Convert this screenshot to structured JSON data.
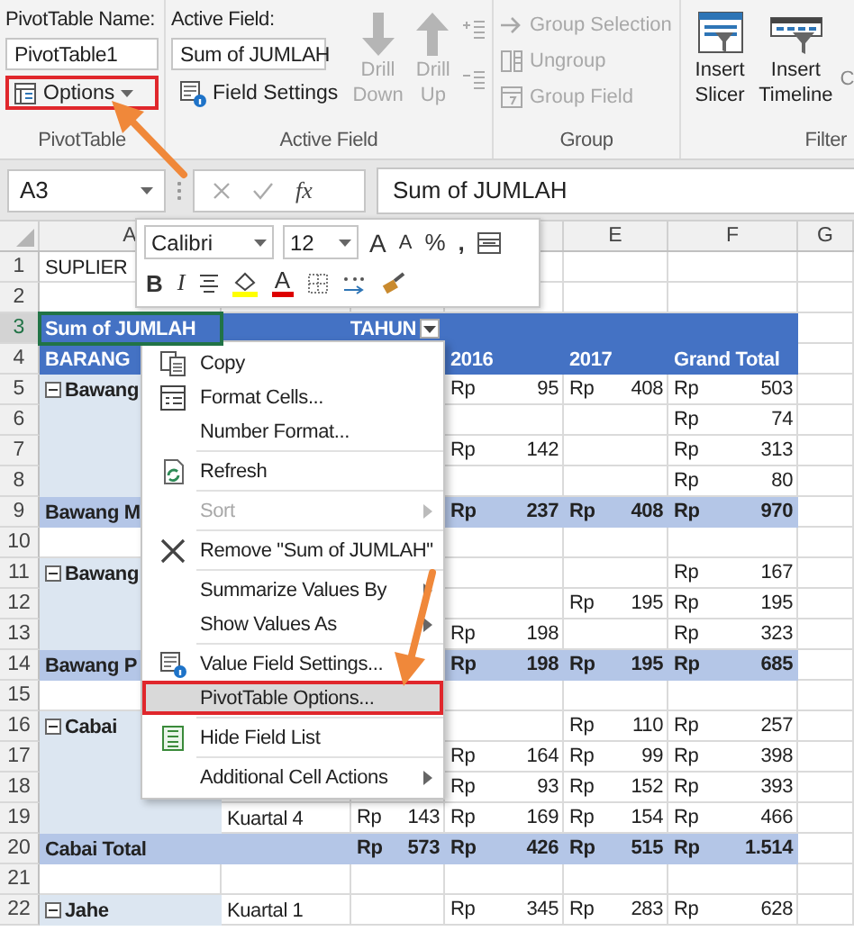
{
  "ribbon": {
    "pivottable_group": {
      "name_label": "PivotTable Name:",
      "name_value": "PivotTable1",
      "options_button": {
        "label": "Options",
        "highlighted": true
      },
      "label": "PivotTable"
    },
    "active_field_group": {
      "field_label": "Active Field:",
      "field_value": "Sum of JUMLAH",
      "settings_button": "Field Settings",
      "drill_buttons": [
        {
          "label": "Drill Down",
          "disabled": true
        },
        {
          "label": "Drill Up",
          "disabled": true
        }
      ],
      "label": "Active Field"
    },
    "group_group": {
      "buttons": [
        {
          "label": "Group Selection",
          "disabled": true
        },
        {
          "label": "Ungroup",
          "disabled": true
        },
        {
          "label": "Group Field",
          "disabled": true
        }
      ],
      "label": "Group"
    },
    "filter_group": {
      "buttons": [
        "Insert Slicer",
        "Insert Timeline"
      ],
      "cut_text": "C",
      "label": "Filter"
    }
  },
  "formula_bar": {
    "name_box": "A3",
    "insert_function": "fx",
    "formula": "Sum of JUMLAH"
  },
  "mini_toolbar": {
    "font": "Calibri",
    "size": "12",
    "grow_font": "A",
    "shrink_font": "A",
    "percent": "%",
    "comma": ",",
    "bold": "B",
    "italic": "I",
    "font_color_button": "A"
  },
  "column_headers": {
    "a": "A",
    "e": "E",
    "f": "F",
    "g": "G"
  },
  "rows": [
    {
      "number": "1",
      "kind": "plain",
      "selected": false,
      "cells": {
        "a": "SUPLIER"
      }
    },
    {
      "number": "2",
      "kind": "plain",
      "selected": false,
      "cells": {}
    },
    {
      "number": "3",
      "kind": "header",
      "selected": true,
      "filter_button": true,
      "cells": {
        "a": "Sum of JUMLAH",
        "c": "TAHUN"
      }
    },
    {
      "number": "4",
      "kind": "header",
      "selected": false,
      "filter_button": false,
      "cells": {
        "a": "BARANG",
        "d": "2016",
        "e": "2017",
        "f": "Grand Total"
      }
    },
    {
      "number": "5",
      "kind": "group",
      "expanded": true,
      "selected": false,
      "cells": {
        "a": "Bawang",
        "d": "Rp 95",
        "e": "Rp 408",
        "f": "Rp 503"
      }
    },
    {
      "number": "6",
      "kind": "detail",
      "selected": false,
      "cells": {
        "f": "Rp 74"
      }
    },
    {
      "number": "7",
      "kind": "detail",
      "selected": false,
      "cells": {
        "d": "Rp 142",
        "f": "Rp 313"
      }
    },
    {
      "number": "8",
      "kind": "detail",
      "selected": false,
      "cells": {
        "f": "Rp 80"
      }
    },
    {
      "number": "9",
      "kind": "total",
      "selected": false,
      "cells": {
        "a": "Bawang M",
        "d": "Rp 237",
        "e": "Rp 408",
        "f": "Rp 970"
      }
    },
    {
      "number": "10",
      "kind": "plain",
      "selected": false,
      "cells": {}
    },
    {
      "number": "11",
      "kind": "group",
      "expanded": true,
      "selected": false,
      "cells": {
        "a": "Bawang",
        "f": "Rp 167"
      }
    },
    {
      "number": "12",
      "kind": "detail",
      "selected": false,
      "cells": {
        "e": "Rp 195",
        "f": "Rp 195"
      }
    },
    {
      "number": "13",
      "kind": "detail",
      "selected": false,
      "cells": {
        "d": "Rp 198",
        "f": "Rp 323"
      }
    },
    {
      "number": "14",
      "kind": "total",
      "selected": false,
      "cells": {
        "a": "Bawang P",
        "d": "Rp 198",
        "e": "Rp 195",
        "f": "Rp 685"
      }
    },
    {
      "number": "15",
      "kind": "plain",
      "selected": false,
      "cells": {}
    },
    {
      "number": "16",
      "kind": "group",
      "expanded": true,
      "selected": false,
      "cells": {
        "a": "Cabai",
        "e": "Rp 110",
        "f": "Rp 257"
      }
    },
    {
      "number": "17",
      "kind": "detail",
      "selected": false,
      "cells": {
        "d": "Rp 164",
        "e": "Rp 99",
        "f": "Rp 398"
      }
    },
    {
      "number": "18",
      "kind": "detail",
      "selected": false,
      "cells": {
        "d": "Rp 93",
        "e": "Rp 152",
        "f": "Rp 393"
      }
    },
    {
      "number": "19",
      "kind": "detail",
      "selected": false,
      "cells": {
        "b": "Kuartal 4",
        "c": "Rp 143",
        "d": "Rp 169",
        "e": "Rp 154",
        "f": "Rp 466"
      }
    },
    {
      "number": "20",
      "kind": "total",
      "selected": false,
      "cells": {
        "a": "Cabai Total",
        "c": "Rp 573",
        "d": "Rp 426",
        "e": "Rp 515",
        "f": "Rp 1.514"
      }
    },
    {
      "number": "21",
      "kind": "plain",
      "selected": false,
      "cells": {}
    },
    {
      "number": "22",
      "kind": "group",
      "expanded": true,
      "selected": false,
      "cells": {
        "a": "Jahe",
        "b": "Kuartal 1",
        "d": "Rp 345",
        "e": "Rp 283",
        "f": "Rp 628"
      }
    }
  ],
  "context_menu": {
    "groups": [
      [
        {
          "label": "Copy",
          "disabled": false,
          "submenu": false,
          "selected": false,
          "highlighted": false
        },
        {
          "label": "Format Cells...",
          "disabled": false,
          "submenu": false,
          "selected": false,
          "highlighted": false
        },
        {
          "label": "Number Format...",
          "disabled": false,
          "submenu": false,
          "selected": false,
          "highlighted": false
        }
      ],
      [
        {
          "label": "Refresh",
          "disabled": false,
          "submenu": false,
          "selected": false,
          "highlighted": false
        }
      ],
      [
        {
          "label": "Sort",
          "disabled": true,
          "submenu": true,
          "selected": false,
          "highlighted": false
        }
      ],
      [
        {
          "label": "Remove \"Sum of JUMLAH\"",
          "disabled": false,
          "submenu": false,
          "selected": false,
          "highlighted": false
        }
      ],
      [
        {
          "label": "Summarize Values By",
          "disabled": false,
          "submenu": true,
          "selected": false,
          "highlighted": false
        },
        {
          "label": "Show Values As",
          "disabled": false,
          "submenu": true,
          "selected": false,
          "highlighted": false
        }
      ],
      [
        {
          "label": "Value Field Settings...",
          "disabled": false,
          "submenu": false,
          "selected": false,
          "highlighted": false
        },
        {
          "label": "PivotTable Options...",
          "disabled": false,
          "submenu": false,
          "selected": true,
          "highlighted": true
        }
      ],
      [
        {
          "label": "Hide Field List",
          "disabled": false,
          "submenu": false,
          "selected": false,
          "highlighted": false
        }
      ],
      [
        {
          "label": "Additional Cell Actions",
          "disabled": false,
          "submenu": true,
          "selected": false,
          "highlighted": false
        }
      ]
    ]
  }
}
